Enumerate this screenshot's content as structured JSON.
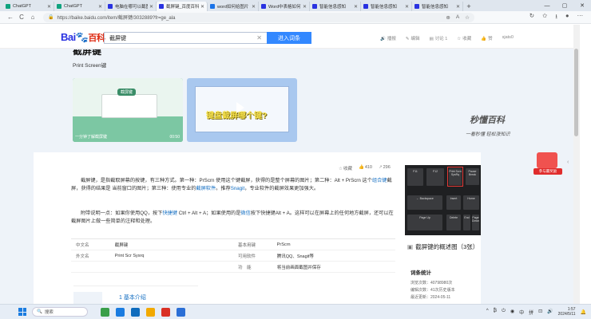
{
  "browser": {
    "tabs": [
      {
        "title": "ChatGPT",
        "color": "#10a37f"
      },
      {
        "title": "ChatGPT",
        "color": "#10a37f"
      },
      {
        "title": "电脑在哪可以截图",
        "color": "#2932e1"
      },
      {
        "title": "截屏键_百度百科",
        "color": "#2932e1",
        "active": true
      },
      {
        "title": "word如何给图片",
        "color": "#1a73e8"
      },
      {
        "title": "Word中表格如何",
        "color": "#2932e1"
      },
      {
        "title": "智能信息感知",
        "color": "#2932e1"
      },
      {
        "title": "智能信息感知",
        "color": "#2932e1"
      },
      {
        "title": "智能信息感知",
        "color": "#2932e1"
      }
    ],
    "new_tab": "+",
    "window_controls": [
      "—",
      "▢",
      "✕"
    ],
    "url": "https://baike.baidu.com/item/截屏键/3032889?fr=ge_ala",
    "nav": {
      "back": "←",
      "refresh": "C",
      "home": "⌂"
    }
  },
  "header": {
    "logo_text": "Bai",
    "logo_paw": "🐾",
    "logo_suffix": "百科",
    "search_value": "截屏键",
    "search_clear": "✕",
    "enter_button": "进入词条",
    "links": [
      {
        "icon": "🔊",
        "label": "播报"
      },
      {
        "icon": "✎",
        "label": "编辑"
      },
      {
        "icon": "▤",
        "label": "讨论 1"
      },
      {
        "icon": "☆",
        "label": "收藏"
      },
      {
        "icon": "👍",
        "label": "赞"
      }
    ],
    "user": "sjats0"
  },
  "entry": {
    "title": "截屏键",
    "subtitle": "Print Screen键",
    "videos": [
      {
        "caption": "一分钟了解截屏键",
        "duration": "00:50",
        "badge": "截屏键"
      },
      {
        "caption": "",
        "duration": "",
        "headline": "键盘截屏哪个键?"
      }
    ],
    "brand": "秒懂百科",
    "brand_slogan": "一看秒懂 轻松涨知识",
    "actions": [
      {
        "icon": "☆",
        "label": "收藏"
      },
      {
        "icon": "👍",
        "label": "410"
      },
      {
        "icon": "↗",
        "label": "296"
      }
    ],
    "paragraph1_parts": [
      "截屏键，是指截取屏幕的按键，有三种方式。第一种：PrScrn 使用这个键截屏，获得的是整个屏幕的图片；第二种：Alt + PrScrn 这个",
      "组合键",
      "截屏，获得的结果是 当前窗口的图片；第三种：使用专业的",
      "截屏软件",
      "。推荐",
      "Snagit",
      "，专业软件的截屏效果更加强大。"
    ],
    "paragraph2_parts": [
      "附带说明一点：如果你使用QQ，按下",
      "快捷键",
      " Ctrl + Alt + A；如果使用的是",
      "微信",
      "按下快捷键Alt + A。这样可以在屏幕上的任何地方截屏，还可以在截屏图片上做一些简单的注释和处理。"
    ],
    "info": [
      {
        "k1": "中文名",
        "v1": "截屏键",
        "k2": "基本用键",
        "v2": "PrScrn"
      },
      {
        "k1": "外文名",
        "v1": "Print Scr Sysrq",
        "k2": "可用软件",
        "v2": "腾讯QQ、Snagit等"
      },
      {
        "k1": "",
        "v1": "",
        "k2": "功　能",
        "v2": "将当前画面截图并保存"
      }
    ],
    "catalog_heading": "1  基本介绍",
    "image_caption": "截屏键的概述图（3张）",
    "image_caption_icon": "▣",
    "keys": [
      "F11",
      "F12",
      "Print Scrn SysRq",
      "Pause Break",
      "← Backspace",
      "Insert",
      "Home",
      "Page Up",
      "Delete",
      "End",
      "Page Down"
    ],
    "stats": {
      "title": "词条统计",
      "rows": [
        "浏览次数：40798980次",
        "编辑次数：41次历史版本",
        "最近更新：2024-05-11"
      ]
    },
    "gift_label": "参与赢奖励",
    "collapse": "‹"
  },
  "taskbar": {
    "search_placeholder": "搜索",
    "search_icon": "🔍",
    "apps": [
      "#3a9f4a",
      "#1b7ce0",
      "#0f6cbd",
      "#f2a900",
      "#d93025",
      "#2b6fd6"
    ],
    "tray": [
      "^",
      "₿",
      "⏻",
      "◉",
      "中",
      "拼",
      "⊡",
      "🔊"
    ],
    "time": "1:57",
    "date": "2024/5/11",
    "bell": "🔔"
  }
}
